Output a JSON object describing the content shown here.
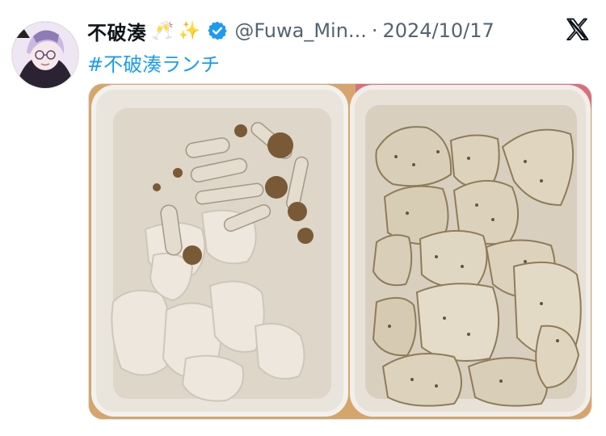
{
  "tweet": {
    "display_name": "不破湊",
    "emoji_glass": "🥂",
    "emoji_sparkle": "✨",
    "handle": "@Fuwa_Min...",
    "separator": "·",
    "date": "2024/10/17",
    "hashtag": "#不破湊ランチ"
  },
  "icons": {
    "avatar": "user-avatar",
    "verified": "verified-badge-icon",
    "logo": "x-logo-icon"
  },
  "colors": {
    "accent": "#1d9bf0",
    "secondary_text": "#536471",
    "primary_text": "#0f1419"
  }
}
